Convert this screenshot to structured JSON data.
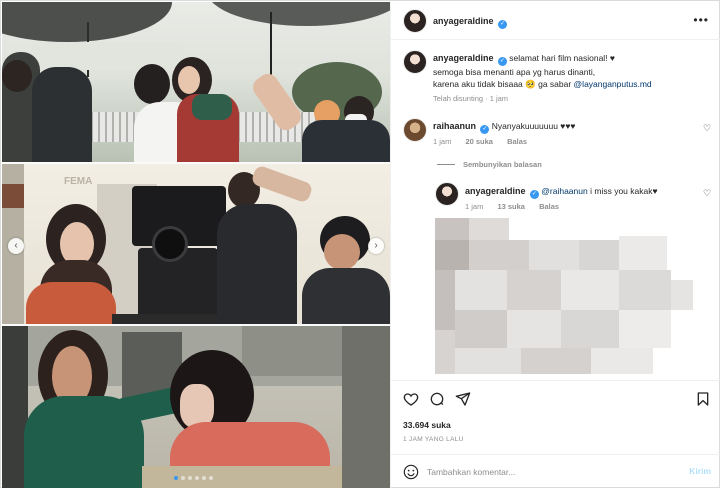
{
  "post": {
    "username": "anyageraldine",
    "verified_icon": "verified-badge-icon",
    "more_icon": "more-options-icon"
  },
  "caption": {
    "username": "anyageraldine",
    "line1": "selamat hari film nasional! ♥",
    "line2": "semoga bisa menanti apa yg harus dinanti,",
    "line3_prefix": "karena aku tidak bisaaa 🥺 ga sabar",
    "mention": "@layanganputus.md",
    "edited": "Telah disunting · 1 jam"
  },
  "comments": [
    {
      "username": "raihaanun",
      "text": "Nyanyakuuuuuuu ♥♥♥",
      "time": "1 jam",
      "likes": "20 suka",
      "reply": "Balas"
    }
  ],
  "hide_replies": "Sembunyikan balasan",
  "reply": {
    "username": "anyageraldine",
    "mention": "@raihaanun",
    "text": "i miss you kakak♥",
    "time": "1 jam",
    "likes": "13 suka",
    "reply_label": "Balas"
  },
  "actions": {
    "like_icon": "heart-icon",
    "comment_icon": "comment-icon",
    "share_icon": "send-icon",
    "save_icon": "bookmark-icon",
    "likes_count": "33.694 suka",
    "timestamp": "1 JAM YANG LALU"
  },
  "composer": {
    "placeholder": "Tambahkan komentar...",
    "send_label": "Kirim",
    "emoji_icon": "emoji-icon"
  },
  "carousel": {
    "prev_icon": "chevron-left-icon",
    "next_icon": "chevron-right-icon",
    "slide_count": 6,
    "active_slide": 1,
    "panel_sign": "FEMA"
  },
  "colors": {
    "verified": "#3897f0",
    "mention": "#00376b",
    "muted": "#8e8e8e",
    "send_disabled": "#b2dffc"
  }
}
